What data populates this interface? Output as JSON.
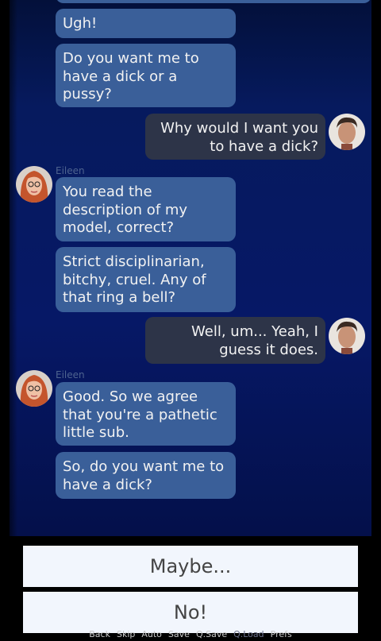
{
  "speaker_name": "Eileen",
  "messages": [
    {
      "text": "Ugh!"
    },
    {
      "text": "Do you want me to have a dick or a pussy?"
    },
    {
      "text": "Why would I want you to have a dick?"
    },
    {
      "text": "You read the description of my model, correct?"
    },
    {
      "text": "Strict disciplinarian, bitchy, cruel. Any of that ring a bell?"
    },
    {
      "text": "Well, um... Yeah, I guess it does."
    },
    {
      "text": "Good. So we agree that you're a pathetic little sub."
    },
    {
      "text": "So, do you want me to have a dick?"
    }
  ],
  "choices": [
    "Maybe...",
    "No!"
  ],
  "quick_menu": [
    "Back",
    "Skip",
    "Auto",
    "Save",
    "Q.Save",
    "Q.Load",
    "Prefs"
  ],
  "colors": {
    "npc_bubble": "#3a5f99",
    "player_bubble": "#2d3448",
    "background": "#061866",
    "choice_bg": "#f2f6fd"
  }
}
